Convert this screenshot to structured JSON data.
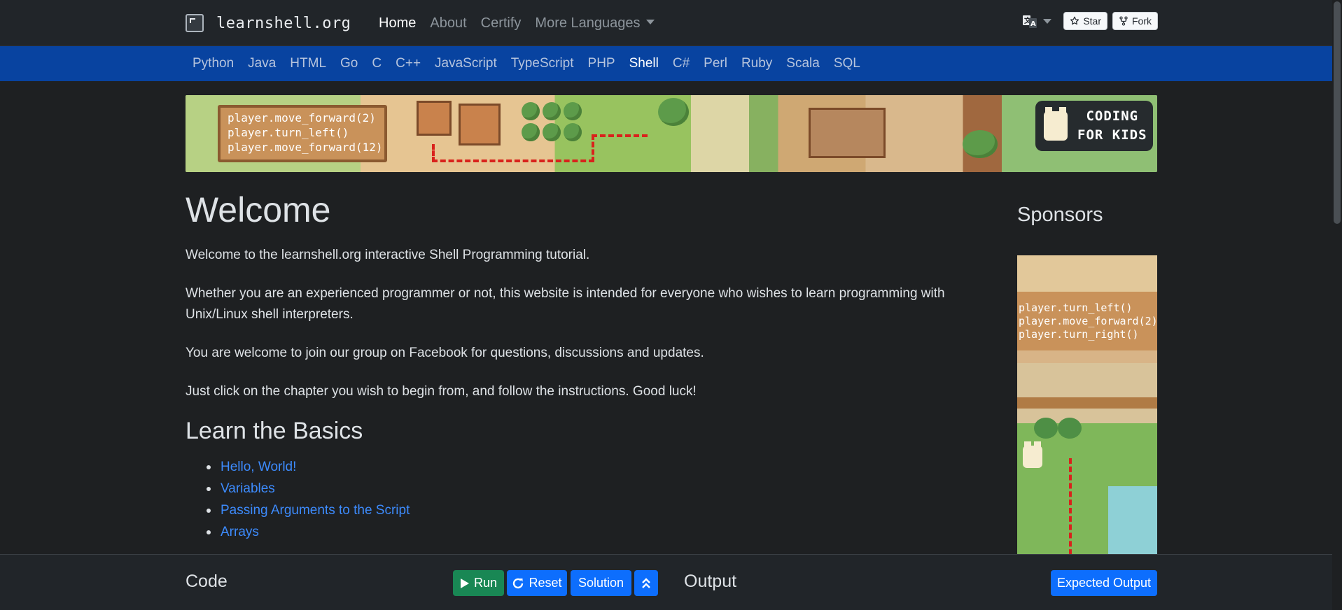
{
  "brand": {
    "name": "learnshell.org"
  },
  "topnav": [
    {
      "label": "Home",
      "active": true
    },
    {
      "label": "About",
      "active": false
    },
    {
      "label": "Certify",
      "active": false
    },
    {
      "label": "More Languages",
      "active": false
    }
  ],
  "github": {
    "star_label": "Star",
    "fork_label": "Fork"
  },
  "languages": [
    {
      "label": "Python",
      "active": false
    },
    {
      "label": "Java",
      "active": false
    },
    {
      "label": "HTML",
      "active": false
    },
    {
      "label": "Go",
      "active": false
    },
    {
      "label": "C",
      "active": false
    },
    {
      "label": "C++",
      "active": false
    },
    {
      "label": "JavaScript",
      "active": false
    },
    {
      "label": "TypeScript",
      "active": false
    },
    {
      "label": "PHP",
      "active": false
    },
    {
      "label": "Shell",
      "active": true
    },
    {
      "label": "C#",
      "active": false
    },
    {
      "label": "Perl",
      "active": false
    },
    {
      "label": "Ruby",
      "active": false
    },
    {
      "label": "Scala",
      "active": false
    },
    {
      "label": "SQL",
      "active": false
    }
  ],
  "banner": {
    "code_lines": [
      "player.move_forward(2)",
      "player.turn_left()",
      "player.move_forward(12)"
    ],
    "badge_line1": "CODING",
    "badge_line2": "FOR KIDS"
  },
  "main": {
    "title": "Welcome",
    "paragraphs": [
      "Welcome to the learnshell.org interactive Shell Programming tutorial.",
      "Whether you are an experienced programmer or not, this website is intended for everyone who wishes to learn programming with Unix/Linux shell interpreters.",
      "You are welcome to join our group on Facebook for questions, discussions and updates.",
      "Just click on the chapter you wish to begin from, and follow the instructions. Good luck!"
    ],
    "section_title": "Learn the Basics",
    "chapters": [
      "Hello, World!",
      "Variables",
      "Passing Arguments to the Script",
      "Arrays"
    ]
  },
  "sponsors": {
    "title": "Sponsors",
    "code_lines": [
      "player.turn_left()",
      "player.move_forward(2)",
      "player.turn_right()"
    ]
  },
  "bottombar": {
    "code_label": "Code",
    "run_label": "Run",
    "reset_label": "Reset",
    "solution_label": "Solution",
    "output_label": "Output",
    "expected_output_label": "Expected Output"
  },
  "colors": {
    "navbar": "#212529",
    "language_bar": "#0843a0",
    "link": "#3d8bfd",
    "run_button": "#198754",
    "primary_button": "#0d6efd"
  }
}
